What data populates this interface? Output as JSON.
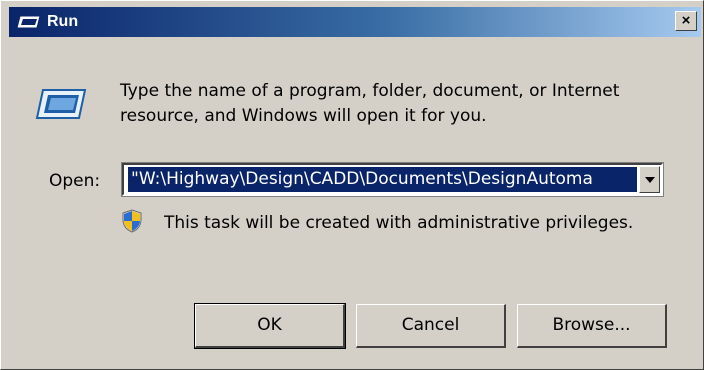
{
  "window": {
    "title": "Run",
    "close_label": "×"
  },
  "dialog": {
    "description": "Type the name of a program, folder, document, or Internet resource, and Windows will open it for you.",
    "open_label": "Open:",
    "open_value": "\"W:\\Highway\\Design\\CADD\\Documents\\DesignAutoma",
    "admin_note": "This task will be created with administrative privileges."
  },
  "buttons": {
    "ok": "OK",
    "cancel": "Cancel",
    "browse": "Browse..."
  },
  "icons": {
    "title": "run-icon",
    "main": "run-icon",
    "admin": "uac-shield-icon",
    "combo_arrow": "chevron-down-icon"
  },
  "colors": {
    "titlebar_start": "#0a246a",
    "titlebar_end": "#a6caf0",
    "dialog_bg": "#d4d0c8",
    "selection_bg": "#0a246a"
  }
}
